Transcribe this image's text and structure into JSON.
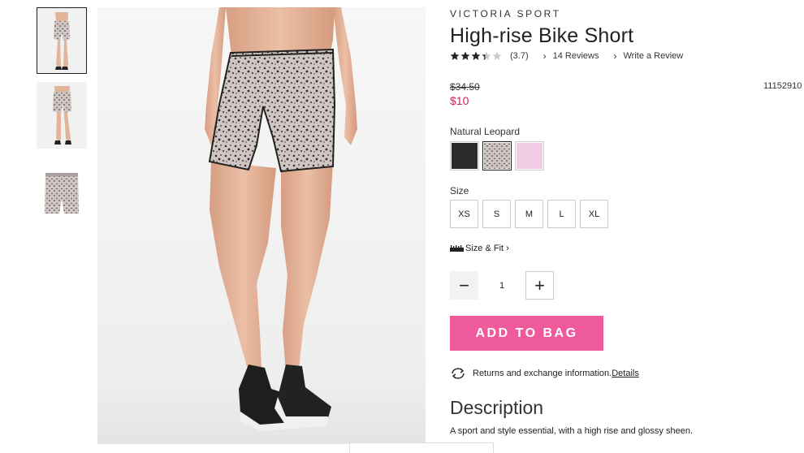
{
  "brand": "VICTORIA SPORT",
  "product_title": "High-rise Bike Short",
  "rating": {
    "stars_filled": 3.7,
    "stars_total": 5,
    "value_text": "(3.7)",
    "reviews_link": "14 Reviews",
    "write_review_link": "Write a Review"
  },
  "price": {
    "original": "$34.50",
    "sale": "$10",
    "sku": "11152910"
  },
  "color": {
    "selected_label": "Natural Leopard",
    "swatches": [
      {
        "name": "black",
        "hex": "#2a2a2a"
      },
      {
        "name": "natural-leopard",
        "hex": "#b8aeae"
      },
      {
        "name": "pink",
        "hex": "#efcbe4"
      }
    ]
  },
  "size": {
    "label": "Size",
    "options": [
      "XS",
      "S",
      "M",
      "L",
      "XL"
    ],
    "fit_link": "Size & Fit"
  },
  "quantity": {
    "minus": "−",
    "value": "1",
    "plus": "+"
  },
  "add_to_bag": "ADD TO BAG",
  "returns": {
    "text": "Returns and exchange information.",
    "link": "Details"
  },
  "description": {
    "heading": "Description",
    "text": "A sport and style essential, with a high rise and glossy sheen."
  },
  "colors": {
    "sale_price": "#d11a5a",
    "add_button": "#ef5a9c"
  }
}
